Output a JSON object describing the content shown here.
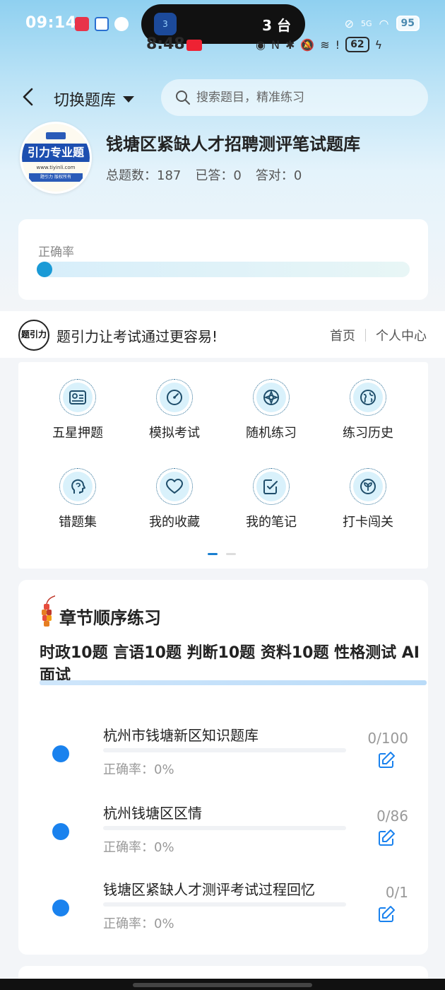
{
  "status_bar": {
    "time": "09:14",
    "island_text": "3 台",
    "island_icon_text": "3",
    "signal": "5G",
    "battery": "95",
    "overlay_time": "8:48",
    "overlay_battery": "62"
  },
  "header": {
    "switch_label": "切换题库",
    "search_placeholder": "搜索题目，精准练习"
  },
  "bank": {
    "logo_text": "引力专业题",
    "logo_url": "www.tiyinli.com",
    "logo_footer": "题引力 版权所有",
    "title": "钱塘区紧缺人才招聘测评笔试题库",
    "total_label": "总题数：",
    "total_value": "187",
    "answered_label": "已答：",
    "answered_value": "0",
    "correct_label": "答对：",
    "correct_value": "0"
  },
  "accuracy": {
    "label": "正确率",
    "value": 0
  },
  "promo": {
    "logo_text": "题引力",
    "text": "题引力让考试通过更容易!",
    "home": "首页",
    "personal": "个人中心"
  },
  "features": [
    {
      "label": "五星押题",
      "icon": "id-card-icon"
    },
    {
      "label": "模拟考试",
      "icon": "gauge-icon"
    },
    {
      "label": "随机练习",
      "icon": "compass-icon"
    },
    {
      "label": "练习历史",
      "icon": "globe-icon"
    },
    {
      "label": "错题集",
      "icon": "head-icon"
    },
    {
      "label": "我的收藏",
      "icon": "heart-icon"
    },
    {
      "label": "我的笔记",
      "icon": "note-check-icon"
    },
    {
      "label": "打卡闯关",
      "icon": "sprout-icon"
    }
  ],
  "chapter": {
    "title": "章节顺序练习",
    "tags": "时政10题 言语10题 判断10题 资料10题 性格测试 AI面试",
    "rows": [
      {
        "name": "杭州市钱塘新区知识题库",
        "accuracy": "正确率：0%",
        "count": "0/100"
      },
      {
        "name": "杭州钱塘区区情",
        "accuracy": "正确率：0%",
        "count": "0/86"
      },
      {
        "name": "钱塘区紧缺人才测评考试过程回忆",
        "accuracy": "正确率：0%",
        "count": "0/1"
      }
    ]
  },
  "colors": {
    "accent": "#1a82ee",
    "progress": "#1a9ad6"
  }
}
